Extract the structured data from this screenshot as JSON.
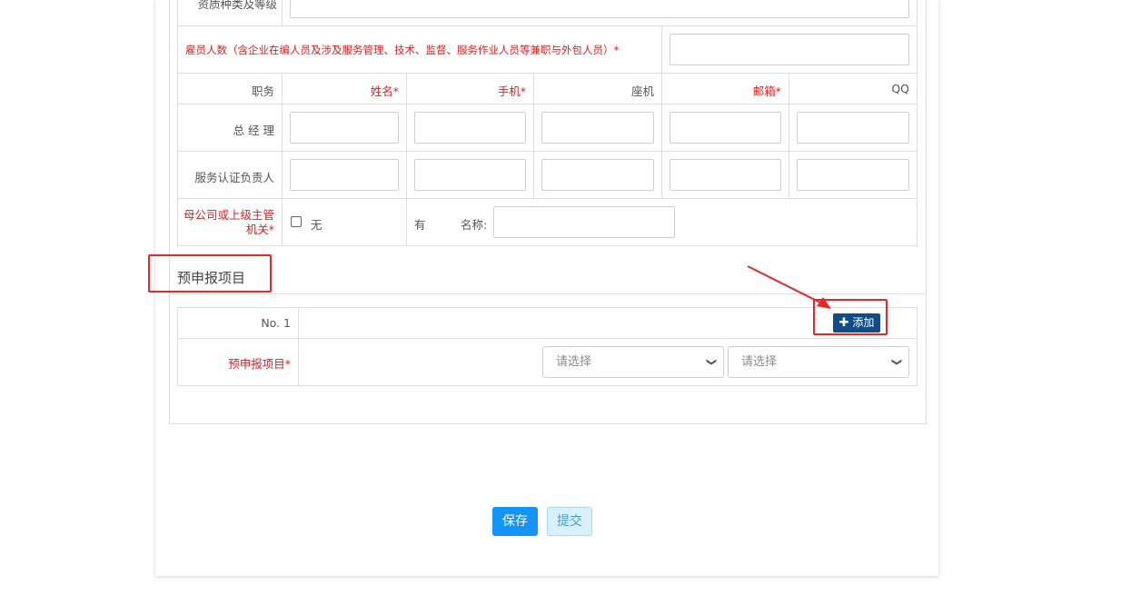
{
  "table": {
    "qualification_label": "资质种类及等级",
    "employees_label": "雇员人数（含企业在编人员及涉及服务管理、技术、监督、服务作业人员等兼职与外包人员）*",
    "headers": {
      "position": "职务",
      "name": "姓名*",
      "mobile": "手机*",
      "landline": "座机",
      "email": "邮箱*",
      "qq": "QQ"
    },
    "rows": [
      {
        "role": "总 经 理"
      },
      {
        "role": "服务认证负责人"
      }
    ],
    "parent_label": "母公司或上级主管机关*",
    "parent_label_line1": "母公司或上级主管",
    "parent_label_line2": "机关*",
    "option_none": "无",
    "option_has": "有",
    "name_label": "名称:"
  },
  "section": {
    "title": "预申报项目",
    "row_no": "No. 1",
    "add_button": "添加",
    "project_label": "预申报项目*",
    "select1_placeholder": "请选择",
    "select2_placeholder": "请选择"
  },
  "actions": {
    "save": "保存",
    "submit": "提交"
  },
  "colors": {
    "primary": "#1495f5",
    "add_button": "#124c86",
    "required": "#e02020",
    "annotation": "#e8262a"
  }
}
